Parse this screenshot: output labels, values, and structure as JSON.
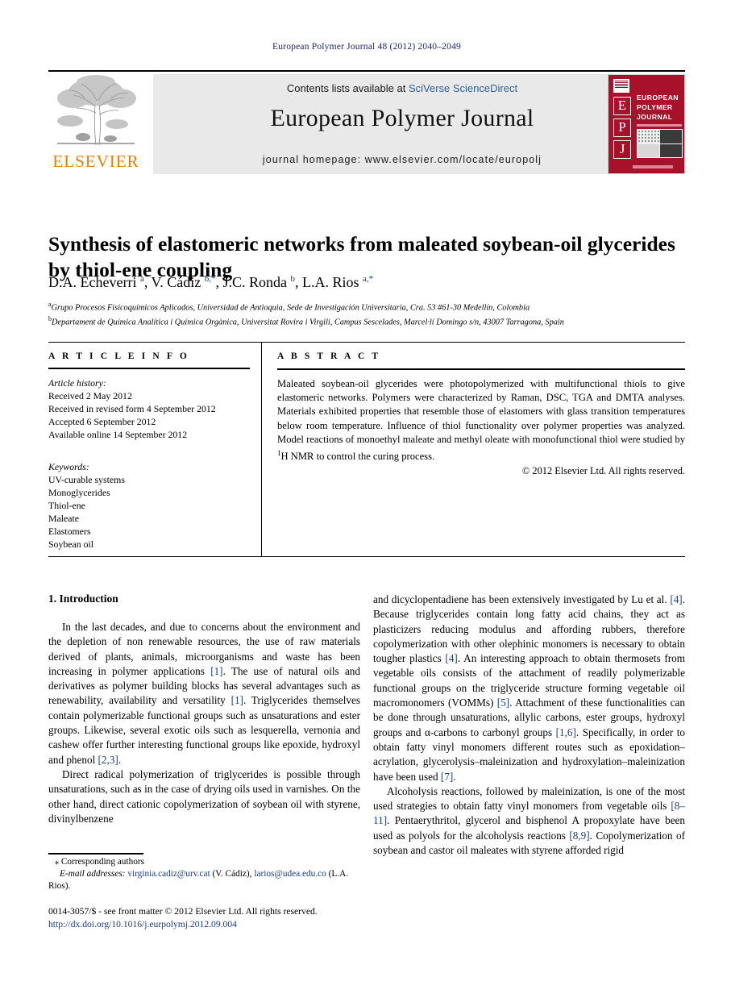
{
  "running_head": "European Polymer Journal 48 (2012) 2040–2049",
  "header": {
    "contents_prefix": "Contents lists available at ",
    "contents_link": "SciVerse ScienceDirect",
    "journal_title": "European Polymer Journal",
    "homepage": "journal homepage: www.elsevier.com/locate/europolj",
    "elsevier_wordmark": "ELSEVIER",
    "cover": {
      "letters": [
        "E",
        "P",
        "J"
      ],
      "title_lines": [
        "EUROPEAN",
        "POLYMER",
        "JOURNAL"
      ]
    }
  },
  "article": {
    "title": "Synthesis of elastomeric networks from maleated soybean-oil glycerides by thiol-ene coupling",
    "authors_html": "D.A. Echeverri <sup>a</sup>, V. Cádiz <sup>b,*</sup>, J.C. Ronda <sup>b</sup>, L.A. Rios <sup>a,*</sup>",
    "affiliations": [
      "Grupo Procesos Fisicoquímicos Aplicados, Universidad de Antioquia, Sede de Investigación Universitaria, Cra. 53 #61-30 Medellín, Colombia",
      "Departament de Química Analítica i Química Orgànica, Universitat Rovira i Virgili, Campus Sescelades, Marcel·lí Domingo s/n, 43007 Tarragona, Spain"
    ],
    "affiliation_marks": [
      "a",
      "b"
    ]
  },
  "article_info": {
    "heading": "A R T I C L E   I N F O",
    "history_label": "Article history:",
    "history": [
      "Received 2 May 2012",
      "Received in revised form 4 September 2012",
      "Accepted 6 September 2012",
      "Available online 14 September 2012"
    ],
    "keywords_label": "Keywords:",
    "keywords": [
      "UV-curable systems",
      "Monoglycerides",
      "Thiol-ene",
      "Maleate",
      "Elastomers",
      "Soybean oil"
    ]
  },
  "abstract": {
    "heading": "A B S T R A C T",
    "text_html": "Maleated soybean-oil glycerides were photopolymerized with multifunctional thiols to give elastomeric networks. Polymers were characterized by Raman, DSC, TGA and DMTA analyses. Materials exhibited properties that resemble those of elastomers with glass transition temperatures below room temperature. Influence of thiol functionality over polymer properties was analyzed. Model reactions of monoethyl maleate and methyl oleate with monofunctional thiol were studied by <sup>1</sup>H NMR to control the curing process.",
    "copyright": "© 2012 Elsevier Ltd. All rights reserved."
  },
  "body": {
    "section_heading": "1. Introduction",
    "left_paragraphs_html": [
      "In the last decades, and due to concerns about the environment and the depletion of non renewable resources, the use of raw materials derived of plants, animals, microorganisms and waste has been increasing in polymer applications <span class=\"ref\">[1]</span>. The use of natural oils and derivatives as polymer building blocks has several advantages such as renewability, availability and versatility <span class=\"ref\">[1]</span>. Triglycerides themselves contain polymerizable functional groups such as unsaturations and ester groups. Likewise, several exotic oils such as lesquerella, vernonia and cashew offer further interesting functional groups like epoxide, hydroxyl and phenol <span class=\"ref\">[2,3]</span>.",
      "Direct radical polymerization of triglycerides is possible through unsaturations, such as in the case of drying oils used in varnishes. On the other hand, direct cationic copolymerization of soybean oil with styrene, divinylbenzene"
    ],
    "right_paragraphs_html": [
      "and dicyclopentadiene has been extensively investigated by Lu et al. <span class=\"ref\">[4]</span>. Because triglycerides contain long fatty acid chains, they act as plasticizers reducing modulus and affording rubbers, therefore copolymerization with other olephinic monomers is necessary to obtain tougher plastics <span class=\"ref\">[4]</span>. An interesting approach to obtain thermosets from vegetable oils consists of the attachment of readily polymerizable functional groups on the triglyceride structure forming vegetable oil macromonomers (VOMMs) <span class=\"ref\">[5]</span>. Attachment of these functionalities can be done through unsaturations, allylic carbons, ester groups, hydroxyl groups and α-carbons to carbonyl groups <span class=\"ref\">[1,6]</span>. Specifically, in order to obtain fatty vinyl monomers different routes such as epoxidation–acrylation, glycerolysis–maleinization and hydroxylation–maleinization have been used <span class=\"ref\">[7]</span>.",
      "Alcoholysis reactions, followed by maleinization, is one of the most used strategies to obtain fatty vinyl monomers from vegetable oils <span class=\"ref\">[8–11]</span>. Pentaerythritol, glycerol and bisphenol A propoxylate have been used as polyols for the alcoholysis reactions <span class=\"ref\">[8,9]</span>. Copolymerization of soybean and castor oil maleates with styrene afforded rigid"
    ]
  },
  "footnote": {
    "corresponding_html": "<span class=\"star\">⁎</span> Corresponding authors",
    "email_html": "<span class=\"em\">E-mail addresses:</span> <span class=\"mail\">virginia.cadiz@urv.cat</span> (V. Cádiz), <span class=\"mail\">larios@udea.edu.co</span> (L.A. Rios)."
  },
  "imprint": {
    "line1": "0014-3057/$ - see front matter © 2012 Elsevier Ltd. All rights reserved.",
    "doi": "http://dx.doi.org/10.1016/j.eurpolymj.2012.09.004"
  },
  "colors": {
    "running_head": "#23256b",
    "link": "#2e5fa3",
    "reference": "#1a3c8c",
    "elsevier_orange": "#f07d00",
    "cover_red": "#a8112a",
    "band_gray": "#e9e9e9"
  }
}
